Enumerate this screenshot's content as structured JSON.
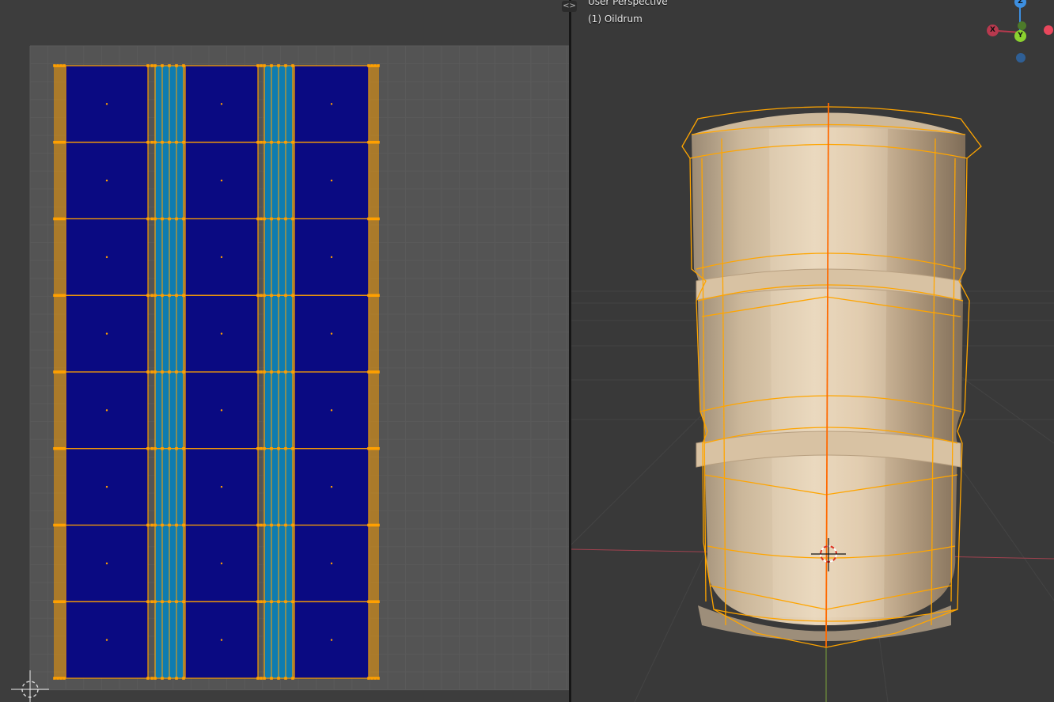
{
  "uv_editor": {
    "columns": [
      {
        "kind": "wide",
        "color": "#0a0a82"
      },
      {
        "kind": "strip",
        "color": "#0e7cb0"
      },
      {
        "kind": "wide",
        "color": "#0a0a82"
      },
      {
        "kind": "strip",
        "color": "#0e7cb0"
      },
      {
        "kind": "wide",
        "color": "#0a0a82"
      }
    ],
    "rows": 8,
    "edge_color": "#ffa000",
    "grid_color": "#5a5a5a"
  },
  "viewport": {
    "perspective_label": "User Perspective",
    "object_label": "(1) Oildrum",
    "object_name": "Oildrum",
    "gizmo": {
      "z_label": "Z",
      "x_label": "X",
      "y_label": "Y",
      "x_color": "#e8475c",
      "y_color": "#8bd12f",
      "z_color": "#3d8fe0"
    },
    "wire_color": "#ffa500",
    "body_color": "#e0cdb0"
  },
  "split_handle": "<>"
}
